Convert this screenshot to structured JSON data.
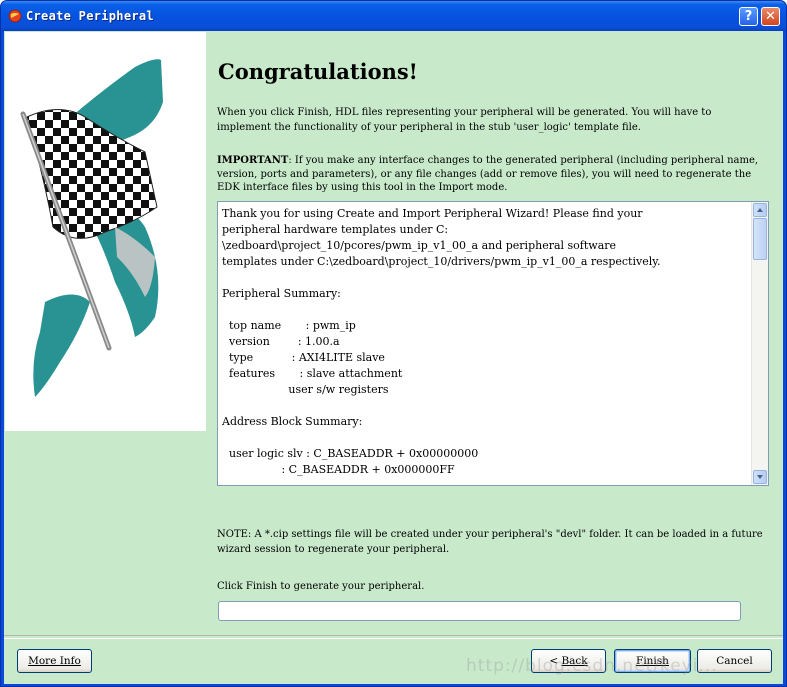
{
  "window": {
    "title": "Create Peripheral",
    "help_label": "?",
    "close_label": "✕"
  },
  "content": {
    "heading": "Congratulations!",
    "intro": "When you click Finish, HDL files representing your peripheral will be generated. You will have to implement the functionality of your peripheral in the stub 'user_logic' template file.",
    "important_label": "IMPORTANT",
    "important_text": ": If you make any interface changes to the generated peripheral (including peripheral name, version, ports and parameters), or any file changes (add or remove files), you will need to regenerate the EDK interface files by using this tool in the Import mode.",
    "summary_text": "Thank you for using Create and Import Peripheral Wizard! Please find your\nperipheral hardware templates under C:\n\\zedboard\\project_10/pcores/pwm_ip_v1_00_a and peripheral software\ntemplates under C:\\zedboard\\project_10/drivers/pwm_ip_v1_00_a respectively.\n\nPeripheral Summary:\n\n  top name       : pwm_ip\n  version        : 1.00.a\n  type           : AXI4LITE slave\n  features       : slave attachment\n                   user s/w registers\n\nAddress Block Summary:\n\n  user logic slv : C_BASEADDR + 0x00000000\n                 : C_BASEADDR + 0x000000FF",
    "note": "NOTE: A *.cip settings file will be created under your peripheral's \"devl\" folder. It can be loaded in a future  wizard session to regenerate your peripheral.",
    "finish_hint": "Click Finish to generate your peripheral.",
    "progress_fraction": 0
  },
  "buttons": {
    "more_info": "More Info",
    "back_rest": "Back",
    "back_prefix": "< ",
    "finish": "Finish",
    "cancel": "Cancel"
  },
  "watermark": "http://blog.csdn.net/keyi..."
}
